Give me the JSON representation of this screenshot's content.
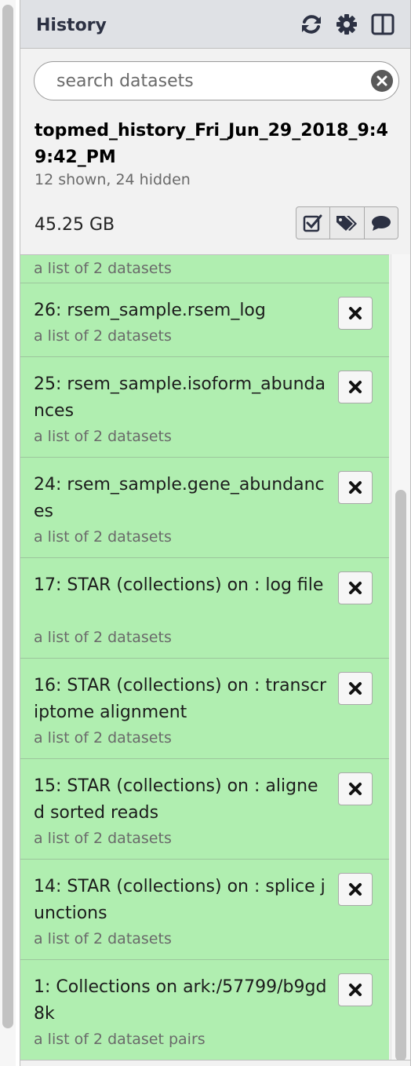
{
  "panel": {
    "title": "History",
    "icons": [
      "refresh-icon",
      "gear-icon",
      "columns-icon"
    ]
  },
  "search": {
    "placeholder": "search datasets",
    "value": ""
  },
  "history": {
    "name": "topmed_history_Fri_Jun_29_2018_9:49:42_PM",
    "counts": "12 shown, 24 hidden",
    "size": "45.25 GB",
    "actions": [
      "select-items-icon",
      "tags-icon",
      "annotation-icon"
    ]
  },
  "items": [
    {
      "title": "",
      "sub": "a list of 2 datasets"
    },
    {
      "title": "26: rsem_sample.rsem_log",
      "sub": "a list of 2 datasets"
    },
    {
      "title": "25: rsem_sample.isoform_abundances",
      "sub": "a list of 2 datasets"
    },
    {
      "title": "24: rsem_sample.gene_abundances",
      "sub": "a list of 2 datasets"
    },
    {
      "title": "17: STAR (collections) on : log file",
      "sub": "a list of 2 datasets"
    },
    {
      "title": "16: STAR (collections) on : transcriptome alignment",
      "sub": "a list of 2 datasets"
    },
    {
      "title": "15: STAR (collections) on : aligned sorted reads",
      "sub": "a list of 2 datasets"
    },
    {
      "title": "14: STAR (collections) on : splice junctions",
      "sub": "a list of 2 datasets"
    },
    {
      "title": "1: Collections on ark:/57799/b9gd8k",
      "sub": "a list of 2 dataset pairs"
    }
  ],
  "colors": {
    "item_ok": "#b0eeb0",
    "header_bg": "#dfe1e5"
  }
}
